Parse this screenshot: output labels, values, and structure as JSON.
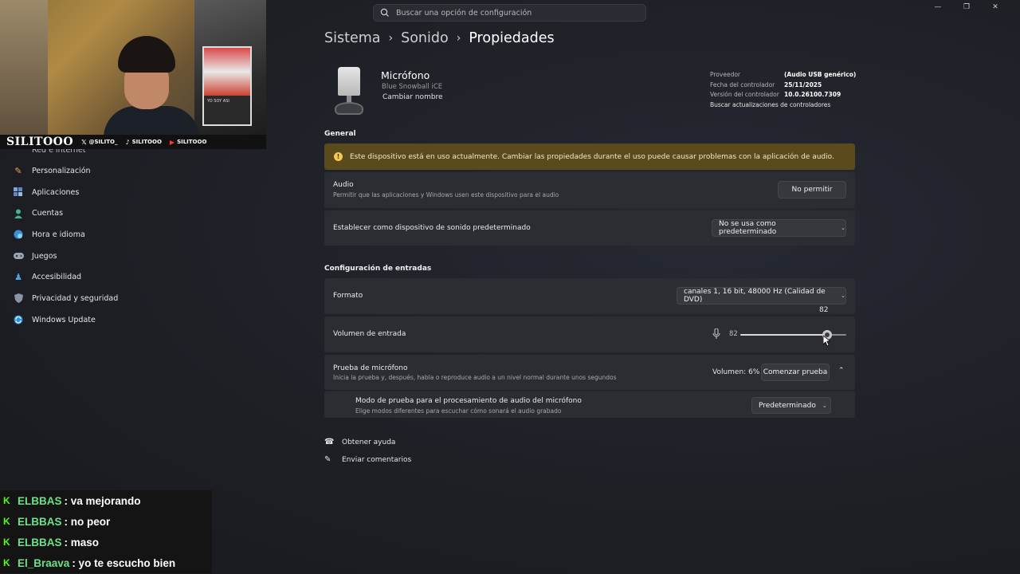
{
  "search": {
    "placeholder": "Buscar una opción de configuración"
  },
  "webcam": {
    "brand": "SILITOOO",
    "socials": [
      {
        "icon": "x-icon",
        "handle": "@SILITO_"
      },
      {
        "icon": "tiktok-icon",
        "handle": "SILITOOO"
      },
      {
        "icon": "youtube-icon",
        "handle": "SILITOOO"
      }
    ],
    "poster_text": "YO SOY ASI"
  },
  "sidebar": {
    "items": [
      {
        "label": "Red e internet",
        "icon": "network-icon"
      },
      {
        "label": "Personalización",
        "icon": "brush-icon"
      },
      {
        "label": "Aplicaciones",
        "icon": "apps-icon"
      },
      {
        "label": "Cuentas",
        "icon": "person-icon"
      },
      {
        "label": "Hora e idioma",
        "icon": "globe-clock-icon"
      },
      {
        "label": "Juegos",
        "icon": "gamepad-icon"
      },
      {
        "label": "Accesibilidad",
        "icon": "accessibility-icon"
      },
      {
        "label": "Privacidad y seguridad",
        "icon": "shield-icon"
      },
      {
        "label": "Windows Update",
        "icon": "update-icon"
      }
    ]
  },
  "chat": [
    {
      "user": "ELBBAS",
      "message": ": va mejorando"
    },
    {
      "user": "ELBBAS",
      "message": ": no peor"
    },
    {
      "user": "ELBBAS",
      "message": ": maso"
    },
    {
      "user": "El_Braava",
      "message": ": yo te escucho bien"
    }
  ],
  "breadcrumb": {
    "level1": "Sistema",
    "level2": "Sonido",
    "current": "Propiedades"
  },
  "device": {
    "name": "Micrófono",
    "model": "Blue Snowball iCE",
    "rename": "Cambiar nombre",
    "properties": {
      "provider_label": "Proveedor",
      "provider_value": "(Audio USB genérico)",
      "date_label": "Fecha del controlador",
      "date_value": "25/11/2025",
      "version_label": "Versión del controlador",
      "version_value": "10.0.26100.7309",
      "update_link": "Buscar actualizaciones de controladores"
    }
  },
  "general": {
    "title": "General",
    "warning": "Este dispositivo está en uso actualmente. Cambiar las propiedades durante el uso puede causar problemas con la aplicación de audio.",
    "audio_label": "Audio",
    "audio_desc": "Permitir que las aplicaciones y Windows usen este dispositivo para el audio",
    "audio_button": "No permitir",
    "default_label": "Establecer como dispositivo de sonido predeterminado",
    "default_value": "No se usa como predeterminado"
  },
  "input_config": {
    "title": "Configuración de entradas",
    "format_label": "Formato",
    "format_value": "canales 1, 16 bit, 48000 Hz (Calidad de DVD)",
    "volume_label": "Volumen de entrada",
    "volume_value": "82",
    "volume_tooltip": "82",
    "volume_level": 82,
    "test_label": "Prueba de micrófono",
    "test_desc": "Inicia la prueba y, después, habla o reproduce audio a un nivel normal durante unos segundos",
    "test_volume": "Volumen: 6%",
    "test_button": "Comenzar prueba",
    "test_mode_label": "Modo de prueba para el procesamiento de audio del micrófono",
    "test_mode_desc": "Elige modos diferentes para escuchar cómo sonará el audio grabado",
    "test_mode_value": "Predeterminado"
  },
  "help": {
    "get_help": "Obtener ayuda",
    "feedback": "Enviar comentarios"
  }
}
